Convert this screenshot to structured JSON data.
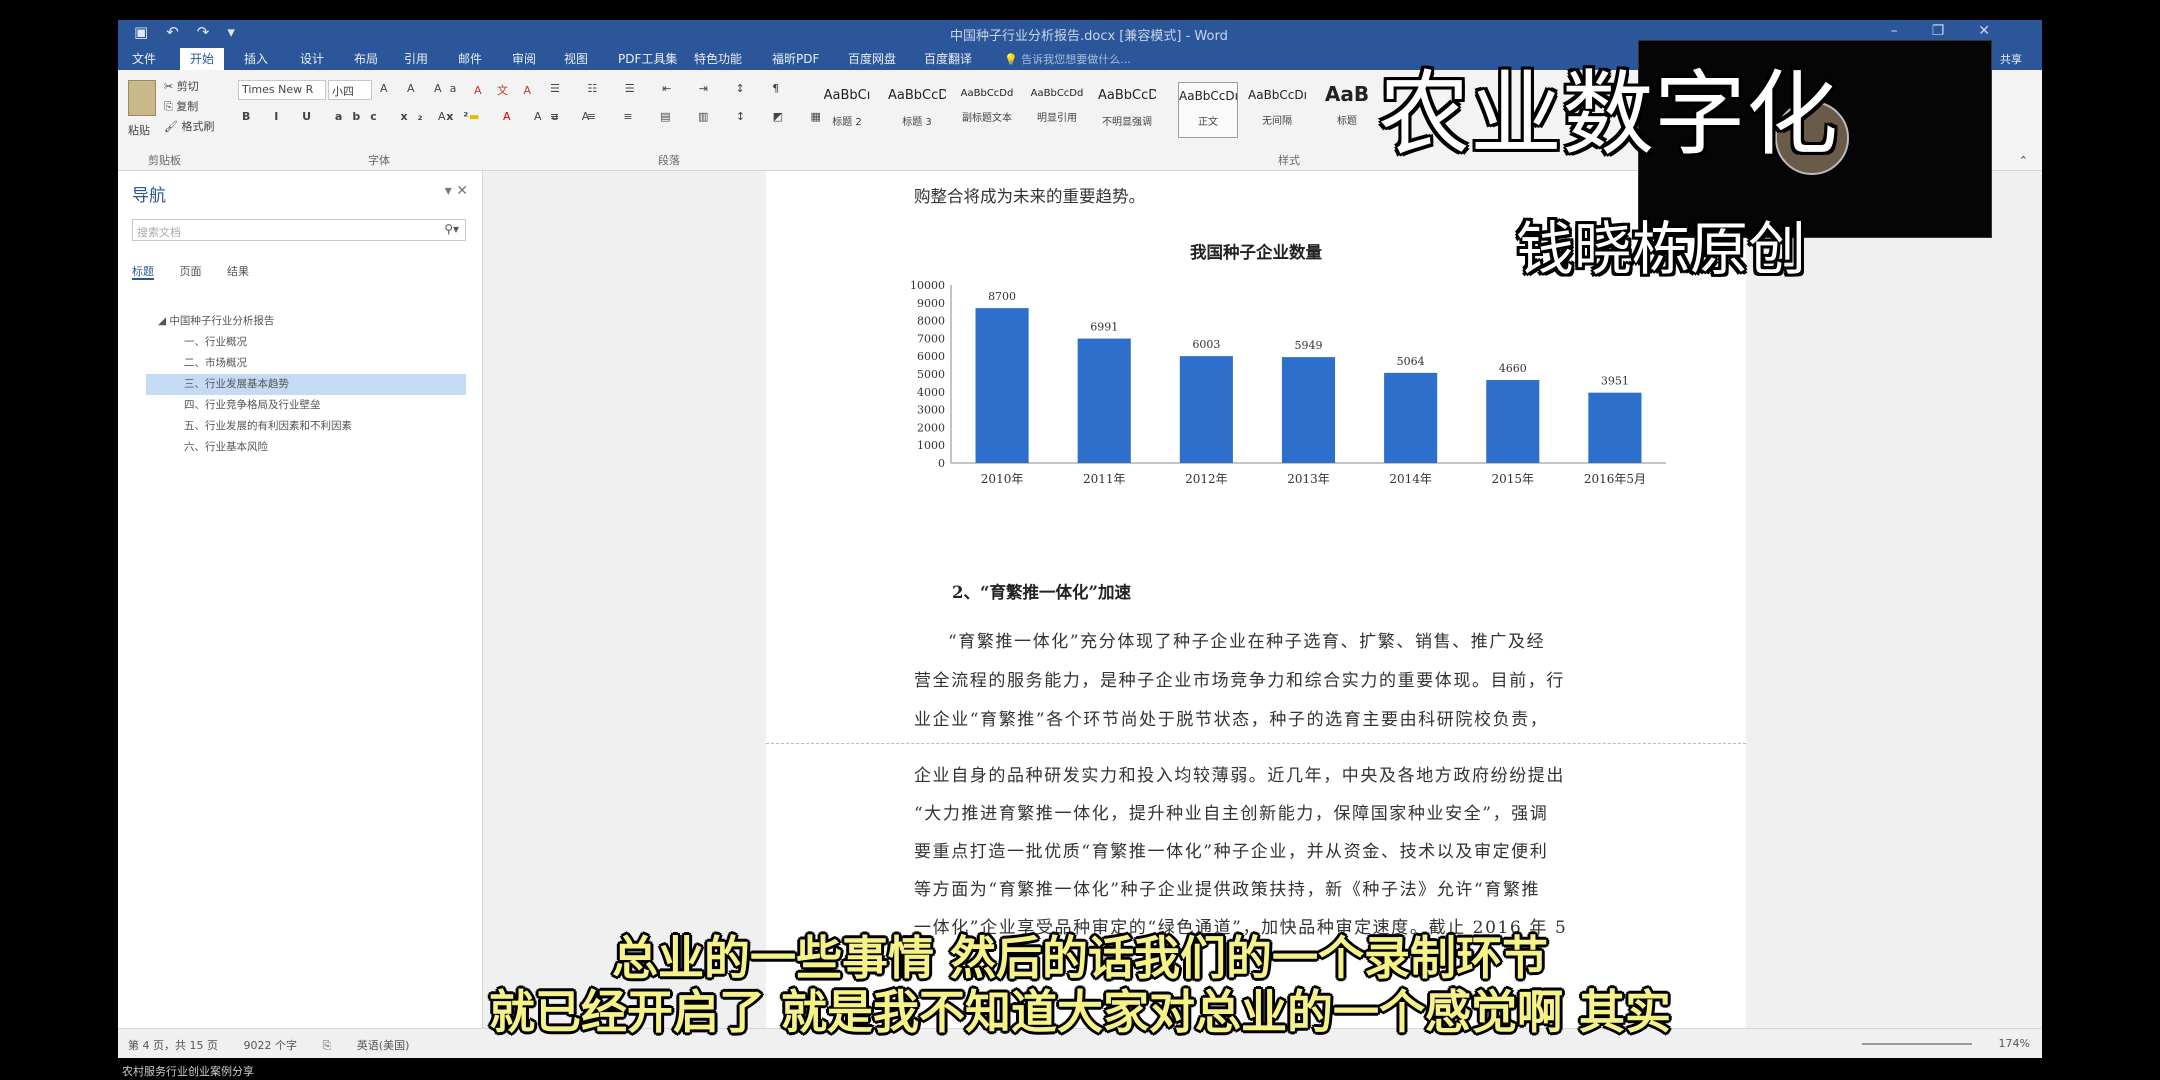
{
  "title_bar": {
    "quick_access": [
      "save-icon",
      "undo-icon",
      "redo-icon",
      "customize-icon"
    ],
    "doc_title": "中国种子行业分析报告.docx [兼容模式] - Word",
    "window_controls": [
      "minimize-icon",
      "restore-icon",
      "close-icon"
    ]
  },
  "tabs": [
    "文件",
    "开始",
    "插入",
    "设计",
    "布局",
    "引用",
    "邮件",
    "审阅",
    "视图",
    "PDF工具集",
    "特色功能",
    "福昕PDF",
    "百度网盘",
    "百度翻译"
  ],
  "active_tab": "开始",
  "tell_me": "告诉我您想要做什么...",
  "share": "共享",
  "ribbon": {
    "clipboard": {
      "paste": "粘贴",
      "cut": "剪切",
      "copy": "复制",
      "format_painter": "格式刷",
      "label": "剪贴板"
    },
    "font": {
      "name": "Times New R",
      "size": "小四",
      "label": "字体"
    },
    "paragraph": {
      "label": "段落"
    },
    "styles_label": "样式",
    "styles": [
      {
        "preview": "AaBbCı",
        "name": "标题 2"
      },
      {
        "preview": "AaBbCcD",
        "name": "标题 3"
      },
      {
        "preview": "AaBbCcDd",
        "name": "副标题文本"
      },
      {
        "preview": "AaBbCcDd",
        "name": "明显引用"
      },
      {
        "preview": "AaBbCcD",
        "name": "不明显强调"
      },
      {
        "preview": "AaBbCcDı",
        "name": "正文"
      },
      {
        "preview": "AaBbCcDı",
        "name": "无间隔"
      },
      {
        "preview": "AaB",
        "name": "标题"
      }
    ]
  },
  "nav": {
    "title": "导航",
    "search_placeholder": "搜索文档",
    "tabs": [
      "标题",
      "页面",
      "结果"
    ],
    "items": [
      {
        "label": "中国种子行业分析报告",
        "level": 0
      },
      {
        "label": "一、行业概况",
        "level": 1
      },
      {
        "label": "二、市场概况",
        "level": 1
      },
      {
        "label": "三、行业发展基本趋势",
        "level": 1,
        "selected": true
      },
      {
        "label": "四、行业竞争格局及行业壁垒",
        "level": 1
      },
      {
        "label": "五、行业发展的有利因素和不利因素",
        "level": 1
      },
      {
        "label": "六、行业基本风险",
        "level": 1
      }
    ]
  },
  "document": {
    "top_line": "购整合将成为未来的重要趋势。",
    "heading": "2、“育繁推一体化”加速",
    "lines_page1": [
      "“育繁推一体化”充分体现了种子企业在种子选育、扩繁、销售、推广及经",
      "营全流程的服务能力，是种子企业市场竞争力和综合实力的重要体现。目前，行",
      "业企业“育繁推”各个环节尚处于脱节状态，种子的选育主要由科研院校负责，"
    ],
    "lines_page2": [
      "企业自身的品种研发实力和投入均较薄弱。近几年，中央及各地方政府纷纷提出",
      "“大力推进育繁推一体化，提升种业自主创新能力，保障国家种业安全”，强调",
      "要重点打造一批优质“育繁推一体化”种子企业，并从资金、技术以及审定便利",
      "等方面为“育繁推一体化”种子企业提供政策扶持，新《种子法》允许“育繁推",
      "一体化”企业享受品种审定的“绿色通道”，加快品种审定速度。截止 2016 年 5",
      "月"
    ]
  },
  "chart_data": {
    "type": "bar",
    "title": "我国种子企业数量",
    "categories": [
      "2010年",
      "2011年",
      "2012年",
      "2013年",
      "2014年",
      "2015年",
      "2016年5月"
    ],
    "values": [
      8700,
      6991,
      6003,
      5949,
      5064,
      4660,
      3951
    ],
    "ylim": [
      0,
      10000
    ],
    "yticks": [
      0,
      1000,
      2000,
      3000,
      4000,
      5000,
      6000,
      7000,
      8000,
      9000,
      10000
    ],
    "bar_color": "#2e6fcb",
    "grid": false
  },
  "status_bar": {
    "page": "第 4 页，共 15 页",
    "words": "9022 个字",
    "lang": "英语(美国)",
    "zoom": "174%"
  },
  "taskbar_text": "农村服务行业创业案例分享",
  "overlay": {
    "title": "农业数字化",
    "author": "钱晓栋原创",
    "subtitle_1": "总业的一些事情 然后的话我们的一个录制环节",
    "subtitle_2": "就已经开启了  就是我不知道大家对总业的一个感觉啊  其实"
  },
  "colors": {
    "word_blue": "#2b579a",
    "subtitle_yellow": "#f5f28a",
    "bar_blue": "#2e6fcb"
  }
}
